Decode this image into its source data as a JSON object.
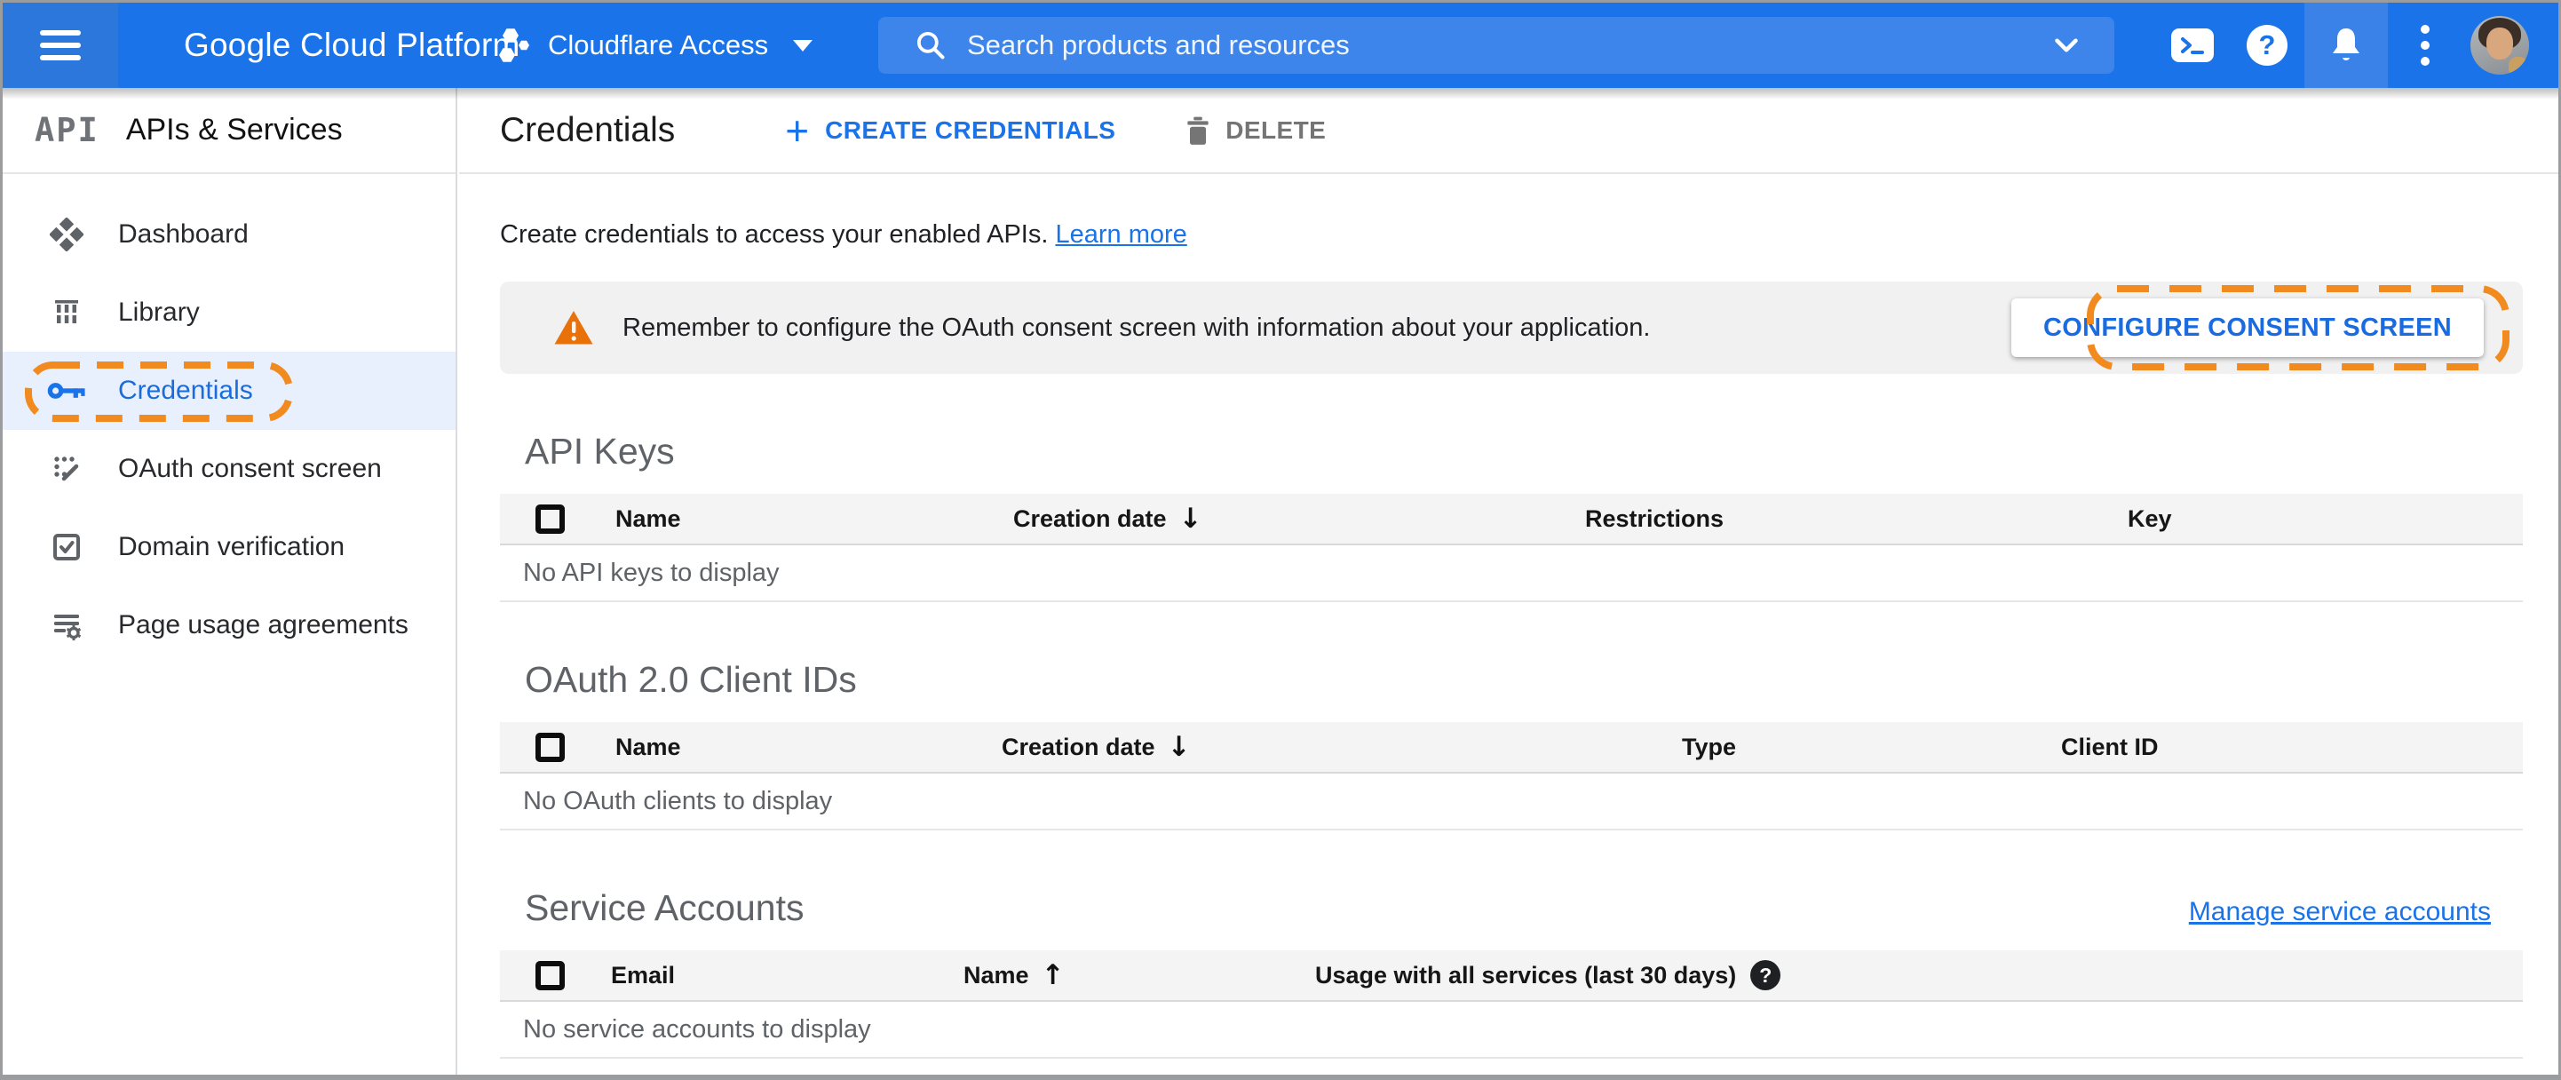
{
  "topbar": {
    "product_name": "Google Cloud Platform",
    "project": {
      "name": "Cloudflare Access",
      "icon": "hexagon-cluster"
    },
    "search": {
      "placeholder": "Search products and resources"
    },
    "colors": {
      "bar": "#1a73e8",
      "menu_area": "#2c77dc",
      "search_bg": "#3d85ea",
      "notification_bg": "#3a82e8"
    }
  },
  "sidebar": {
    "logo_text": "API",
    "title": "APIs & Services",
    "items": [
      {
        "label": "Dashboard",
        "icon": "dashboard-icon",
        "active": false
      },
      {
        "label": "Library",
        "icon": "library-icon",
        "active": false
      },
      {
        "label": "Credentials",
        "icon": "key-icon",
        "active": true,
        "annotated": true
      },
      {
        "label": "OAuth consent screen",
        "icon": "consent-icon",
        "active": false
      },
      {
        "label": "Domain verification",
        "icon": "domain-check-icon",
        "active": false
      },
      {
        "label": "Page usage agreements",
        "icon": "agreements-icon",
        "active": false
      }
    ],
    "active_bg": "#e8f0fe",
    "active_color": "#1a6dd8"
  },
  "page_header": {
    "title": "Credentials",
    "create_label": "CREATE CREDENTIALS",
    "delete_label": "DELETE"
  },
  "content": {
    "intro_text": "Create credentials to access your enabled APIs.",
    "learn_more_label": "Learn more",
    "warning_banner": {
      "text": "Remember to configure the OAuth consent screen with information about your application.",
      "button_label": "CONFIGURE CONSENT SCREEN",
      "icon_color": "#e8710a",
      "bg": "#f1f1f1"
    },
    "sections": [
      {
        "title": "API Keys",
        "columns": [
          "Name",
          "Creation date",
          "Restrictions",
          "Key"
        ],
        "sort": {
          "column": "Creation date",
          "direction": "desc",
          "glyph": "↓"
        },
        "empty_text": "No API keys to display"
      },
      {
        "title": "OAuth 2.0 Client IDs",
        "columns": [
          "Name",
          "Creation date",
          "Type",
          "Client ID"
        ],
        "sort": {
          "column": "Creation date",
          "direction": "desc",
          "glyph": "↓"
        },
        "empty_text": "No OAuth clients to display"
      },
      {
        "title": "Service Accounts",
        "manage_link": "Manage service accounts",
        "columns": [
          "Email",
          "Name",
          "Usage with all services (last 30 days)"
        ],
        "sort": {
          "column": "Name",
          "direction": "asc",
          "glyph": "↑"
        },
        "help_glyph": "?",
        "empty_text": "No service accounts to display"
      }
    ]
  },
  "annotation": {
    "color": "#f28b1f",
    "style": "dashed-rounded-rect"
  },
  "accent_colors": {
    "link_blue": "#1a73e8",
    "warning_orange": "#e8710a",
    "text_gray": "#5f6368"
  }
}
